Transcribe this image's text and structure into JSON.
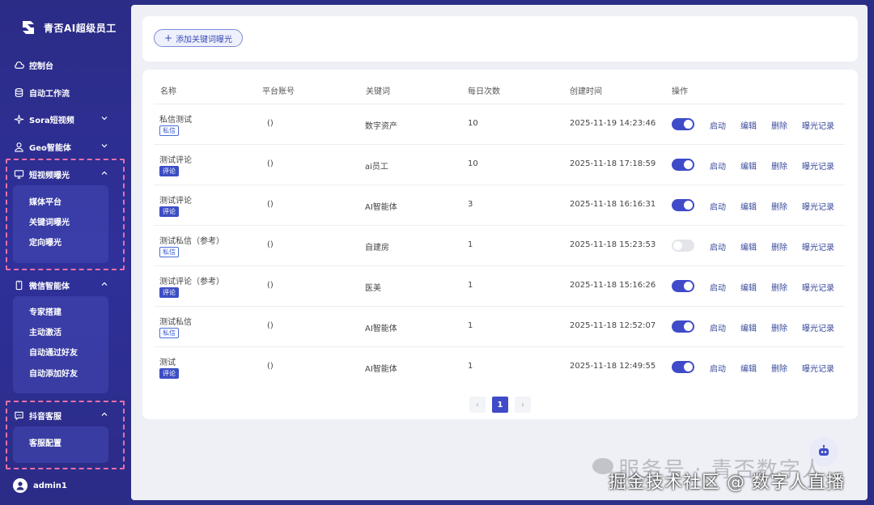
{
  "brand": {
    "name": "青否AI超级员工",
    "logo_icon": "brand-logo-icon"
  },
  "nav": {
    "items": [
      {
        "label": "控制台",
        "icon": "cloud-icon"
      },
      {
        "label": "自动工作流",
        "icon": "database-icon"
      },
      {
        "label": "Sora短视频",
        "icon": "sparkle-icon"
      },
      {
        "label": "Geo智能体",
        "icon": "user-icon"
      },
      {
        "label": "短视频曝光",
        "icon": "monitor-icon"
      },
      {
        "label": "微信智能体",
        "icon": "phone-icon"
      },
      {
        "label": "抖音客服",
        "icon": "chat-icon"
      }
    ],
    "short_video_sub": [
      "媒体平台",
      "关键词曝光",
      "定向曝光"
    ],
    "wechat_sub": [
      "专家搭建",
      "主动激活",
      "自动通过好友",
      "自动添加好友"
    ],
    "douyin_sub": [
      "客服配置"
    ]
  },
  "user": {
    "name": "admin1"
  },
  "toolbar": {
    "add_label": "添加关键词曝光"
  },
  "table": {
    "headers": [
      "名称",
      "平台账号",
      "关键词",
      "每日次数",
      "创建时间",
      "操作"
    ],
    "actions": [
      "启动",
      "编辑",
      "删除",
      "曝光记录"
    ],
    "rows": [
      {
        "name": "私信测试",
        "tag": "私信",
        "account": "()",
        "keyword": "数字资产",
        "count": "10",
        "time": "2025-11-19 14:23:46",
        "enabled": true
      },
      {
        "name": "测试评论",
        "tag": "评论",
        "account": "()",
        "keyword": "ai员工",
        "count": "10",
        "time": "2025-11-18 17:18:59",
        "enabled": true
      },
      {
        "name": "测试评论",
        "tag": "评论",
        "account": "()",
        "keyword": "AI智能体",
        "count": "3",
        "time": "2025-11-18 16:16:31",
        "enabled": true
      },
      {
        "name": "测试私信（参考）",
        "tag": "私信",
        "account": "()",
        "keyword": "自建房",
        "count": "1",
        "time": "2025-11-18 15:23:53",
        "enabled": false
      },
      {
        "name": "测试评论（参考）",
        "tag": "评论",
        "account": "()",
        "keyword": "医美",
        "count": "1",
        "time": "2025-11-18 15:16:26",
        "enabled": true
      },
      {
        "name": "测试私信",
        "tag": "私信",
        "account": "()",
        "keyword": "AI智能体",
        "count": "1",
        "time": "2025-11-18 12:52:07",
        "enabled": true
      },
      {
        "name": "测试",
        "tag": "评论",
        "account": "()",
        "keyword": "AI智能体",
        "count": "1",
        "time": "2025-11-18 12:49:55",
        "enabled": true
      }
    ]
  },
  "pagination": {
    "current": "1",
    "prev": "‹",
    "next": "›"
  },
  "watermark": {
    "line1": "服务号 · 青否数字人",
    "line2": "掘金技术社区 @ 数字人直播"
  },
  "colors": {
    "sidebar": "#2b2c86",
    "accent": "#3f4bc8",
    "highlight": "#e870a8"
  }
}
